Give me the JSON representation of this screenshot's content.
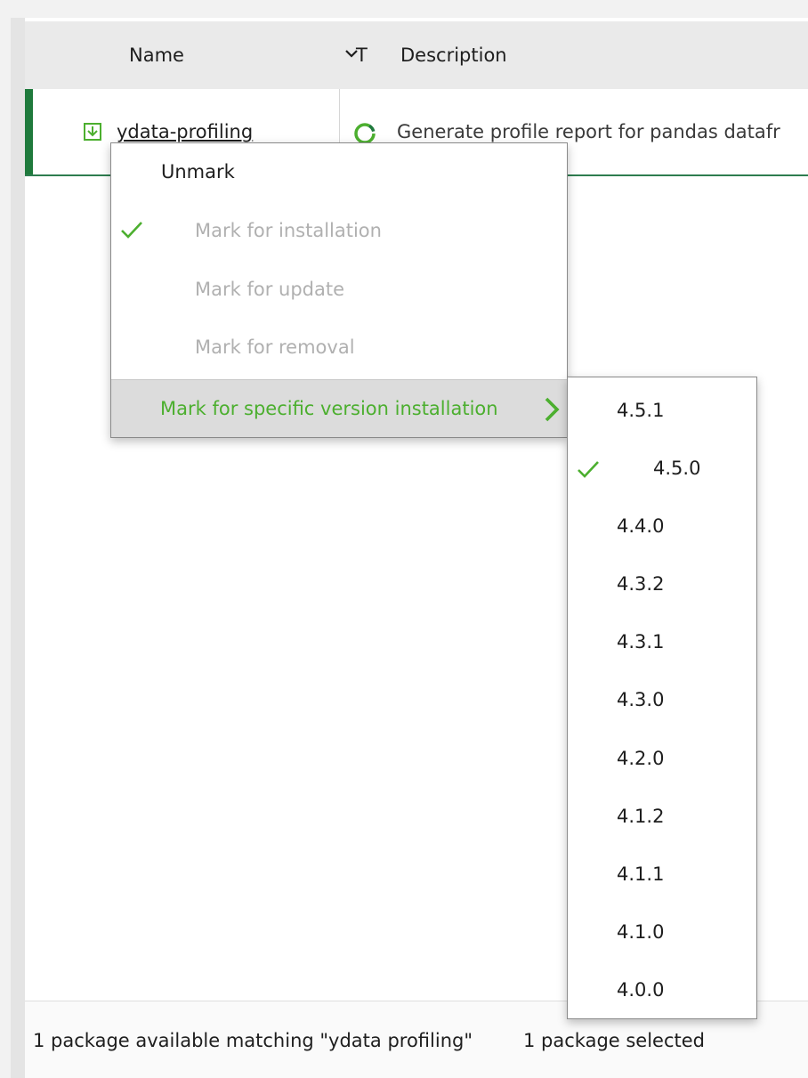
{
  "table": {
    "columns": {
      "name": "Name",
      "type": "T",
      "description": "Description"
    },
    "rows": [
      {
        "name": "ydata-profiling",
        "description": "Generate profile report for pandas datafr"
      }
    ]
  },
  "context_menu": {
    "unmark": "Unmark",
    "mark_install": "Mark for installation",
    "mark_update": "Mark for update",
    "mark_removal": "Mark for removal",
    "mark_specific": "Mark for specific version installation"
  },
  "versions": {
    "v0": "4.5.1",
    "v1": "4.5.0",
    "v2": "4.4.0",
    "v3": "4.3.2",
    "v4": "4.3.1",
    "v5": "4.3.0",
    "v6": "4.2.0",
    "v7": "4.1.2",
    "v8": "4.1.1",
    "v9": "4.1.0",
    "v10": "4.0.0"
  },
  "status_bar": {
    "matching": "1 package available matching \"ydata profiling\"",
    "selected": "1 package selected"
  },
  "colors": {
    "accent_green": "#4caf2f",
    "row_marker": "#1f7a3c"
  }
}
